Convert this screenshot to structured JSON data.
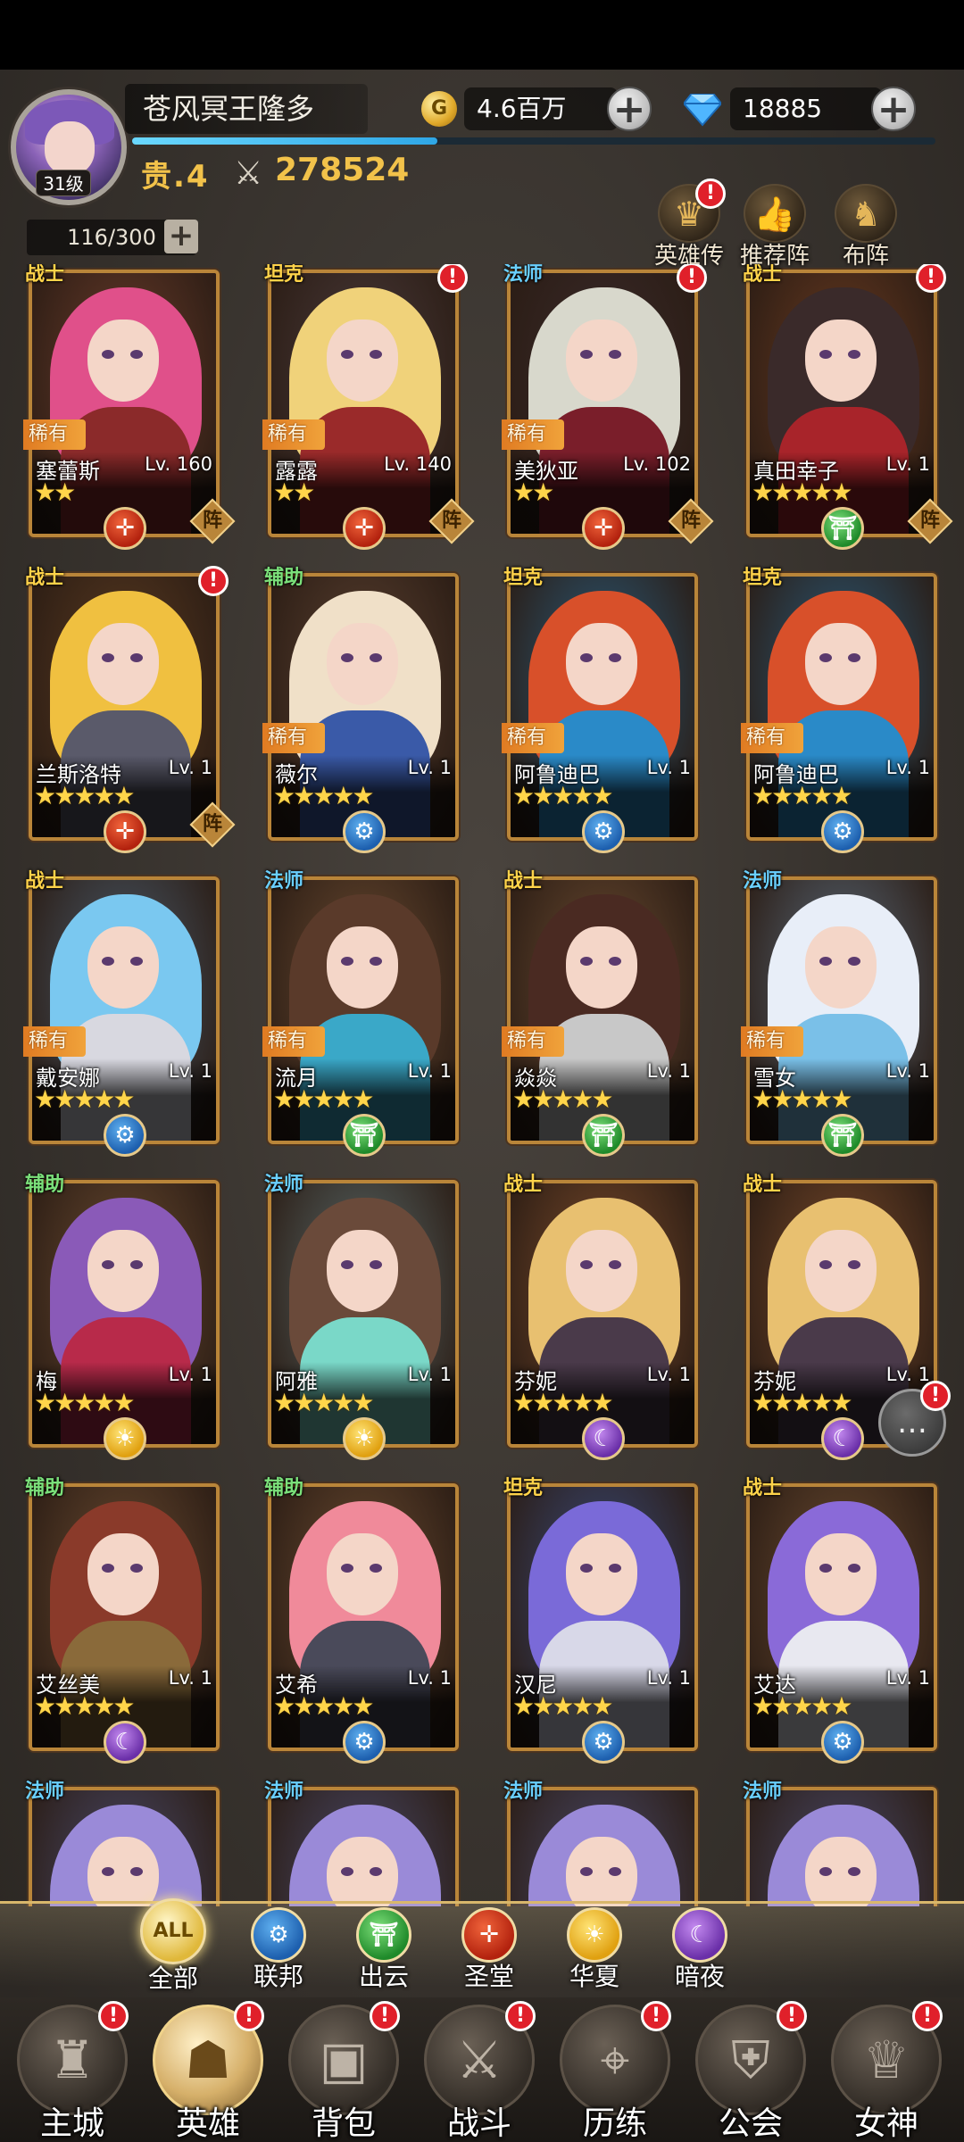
{
  "player": {
    "name": "苍风冥王隆多",
    "level_badge": "31级",
    "vip": "贵.4",
    "power": "278524",
    "xp_fraction": 0.38
  },
  "resources": {
    "coin_icon_glyph": "G",
    "gold": "4.6百万",
    "gems": "18885"
  },
  "capacity": "116/300",
  "top_actions": [
    {
      "label": "英雄传",
      "icon": "crown-icon",
      "glyph": "♛",
      "alert": true
    },
    {
      "label": "推荐阵",
      "icon": "thumbs-up-icon",
      "glyph": "👍",
      "alert": false
    },
    {
      "label": "布阵",
      "icon": "knight-icon",
      "glyph": "♞",
      "alert": false
    }
  ],
  "alert_mark": "!",
  "heroes": [
    {
      "role": "战士",
      "role_color": "#ffd34a",
      "rarity": "稀有",
      "name": "塞蕾斯",
      "level": "Lv. 160",
      "stars": "★★",
      "faction": "sacred",
      "formation": "阵",
      "alert": false,
      "hair": "#e0508a",
      "body": "#8b2a2a",
      "bg": "#6a3b2a"
    },
    {
      "role": "坦克",
      "role_color": "#ffd34a",
      "rarity": "稀有",
      "name": "露露",
      "level": "Lv. 140",
      "stars": "★★",
      "faction": "sacred",
      "formation": "阵",
      "alert": true,
      "hair": "#f0d27a",
      "body": "#9a2a2a",
      "bg": "#4a3a3a"
    },
    {
      "role": "法师",
      "role_color": "#6ad0ff",
      "rarity": "稀有",
      "name": "美狄亚",
      "level": "Lv. 102",
      "stars": "★★",
      "faction": "sacred",
      "formation": "阵",
      "alert": true,
      "hair": "#d8d8cc",
      "body": "#7a1e2a",
      "bg": "#3a2a2a"
    },
    {
      "role": "战士",
      "role_color": "#ffd34a",
      "rarity": "",
      "name": "真田幸子",
      "level": "Lv. 1",
      "stars": "★★★★★",
      "faction": "cloud",
      "formation": "阵",
      "alert": true,
      "hair": "#3a2a2a",
      "body": "#a8242a",
      "bg": "#6a3a20"
    },
    {
      "role": "战士",
      "role_color": "#ffd34a",
      "rarity": "",
      "name": "兰斯洛特",
      "level": "Lv. 1",
      "stars": "★★★★★",
      "faction": "sacred",
      "formation": "阵",
      "alert": true,
      "hair": "#f0c040",
      "body": "#5a5a6a",
      "bg": "#5a3a20"
    },
    {
      "role": "辅助",
      "role_color": "#7be07a",
      "rarity": "稀有",
      "name": "薇尔",
      "level": "Lv. 1",
      "stars": "★★★★★",
      "faction": "union",
      "formation": "",
      "alert": false,
      "hair": "#f0e0c8",
      "body": "#3a5aa8",
      "bg": "#5a4030"
    },
    {
      "role": "坦克",
      "role_color": "#ffd34a",
      "rarity": "稀有",
      "name": "阿鲁迪巴",
      "level": "Lv. 1",
      "stars": "★★★★★",
      "faction": "union",
      "formation": "",
      "alert": false,
      "hair": "#d8502a",
      "body": "#2a8ac8",
      "bg": "#2a5a7a"
    },
    {
      "role": "坦克",
      "role_color": "#ffd34a",
      "rarity": "稀有",
      "name": "阿鲁迪巴",
      "level": "Lv. 1",
      "stars": "★★★★★",
      "faction": "union",
      "formation": "",
      "alert": false,
      "hair": "#d8502a",
      "body": "#2a8ac8",
      "bg": "#2a5a7a"
    },
    {
      "role": "战士",
      "role_color": "#ffd34a",
      "rarity": "稀有",
      "name": "戴安娜",
      "level": "Lv. 1",
      "stars": "★★★★★",
      "faction": "union",
      "formation": "",
      "alert": false,
      "hair": "#7ac8f0",
      "body": "#d8d8e0",
      "bg": "#4a5a6a"
    },
    {
      "role": "法师",
      "role_color": "#6ad0ff",
      "rarity": "稀有",
      "name": "流月",
      "level": "Lv. 1",
      "stars": "★★★★★",
      "faction": "cloud",
      "formation": "",
      "alert": false,
      "hair": "#5a3a2a",
      "body": "#3aa8c8",
      "bg": "#6a4a30"
    },
    {
      "role": "战士",
      "role_color": "#ffd34a",
      "rarity": "稀有",
      "name": "焱焱",
      "level": "Lv. 1",
      "stars": "★★★★★",
      "faction": "cloud",
      "formation": "",
      "alert": false,
      "hair": "#4a2a22",
      "body": "#c8c8c8",
      "bg": "#6a4a30"
    },
    {
      "role": "法师",
      "role_color": "#6ad0ff",
      "rarity": "稀有",
      "name": "雪女",
      "level": "Lv. 1",
      "stars": "★★★★★",
      "faction": "cloud",
      "formation": "",
      "alert": false,
      "hair": "#e8eef8",
      "body": "#7ac0e8",
      "bg": "#5a6a7a"
    },
    {
      "role": "辅助",
      "role_color": "#7be07a",
      "rarity": "",
      "name": "梅",
      "level": "Lv. 1",
      "stars": "★★★★★",
      "faction": "huaxia",
      "formation": "",
      "alert": false,
      "hair": "#8a5ab8",
      "body": "#b82a4a",
      "bg": "#6a4a30"
    },
    {
      "role": "法师",
      "role_color": "#6ad0ff",
      "rarity": "",
      "name": "阿雅",
      "level": "Lv. 1",
      "stars": "★★★★★",
      "faction": "huaxia",
      "formation": "",
      "alert": false,
      "hair": "#6a4a3a",
      "body": "#7ad8c8",
      "bg": "#5a6a6a"
    },
    {
      "role": "战士",
      "role_color": "#ffd34a",
      "rarity": "",
      "name": "芬妮",
      "level": "Lv. 1",
      "stars": "★★★★★",
      "faction": "night",
      "formation": "",
      "alert": false,
      "hair": "#e8c070",
      "body": "#4a3a4a",
      "bg": "#7a4a2a"
    },
    {
      "role": "战士",
      "role_color": "#ffd34a",
      "rarity": "",
      "name": "芬妮",
      "level": "Lv. 1",
      "stars": "★★★★★",
      "faction": "night",
      "formation": "",
      "alert": false,
      "hair": "#e8c070",
      "body": "#4a3a4a",
      "bg": "#7a4a2a"
    },
    {
      "role": "辅助",
      "role_color": "#7be07a",
      "rarity": "",
      "name": "艾丝美",
      "level": "Lv. 1",
      "stars": "★★★★★",
      "faction": "night",
      "formation": "",
      "alert": false,
      "hair": "#8a3a2a",
      "body": "#8a6a3a",
      "bg": "#6a4a30"
    },
    {
      "role": "辅助",
      "role_color": "#7be07a",
      "rarity": "",
      "name": "艾希",
      "level": "Lv. 1",
      "stars": "★★★★★",
      "faction": "union",
      "formation": "",
      "alert": false,
      "hair": "#f08a9a",
      "body": "#4a4a5a",
      "bg": "#6a4a30"
    },
    {
      "role": "坦克",
      "role_color": "#ffd34a",
      "rarity": "",
      "name": "汉尼",
      "level": "Lv. 1",
      "stars": "★★★★★",
      "faction": "union",
      "formation": "",
      "alert": false,
      "hair": "#7a6ad8",
      "body": "#d8d8e8",
      "bg": "#3a4a7a"
    },
    {
      "role": "战士",
      "role_color": "#ffd34a",
      "rarity": "",
      "name": "艾达",
      "level": "Lv. 1",
      "stars": "★★★★★",
      "faction": "union",
      "formation": "",
      "alert": false,
      "hair": "#8a6ad8",
      "body": "#e8e8f0",
      "bg": "#6a4a30"
    },
    {
      "role": "法师",
      "role_color": "#6ad0ff",
      "rarity": "",
      "name": "",
      "level": "",
      "stars": "",
      "faction": "",
      "formation": "",
      "alert": false,
      "hair": "#9a8ad8",
      "body": "#6a7ab8",
      "bg": "#4a4a6a"
    },
    {
      "role": "法师",
      "role_color": "#6ad0ff",
      "rarity": "",
      "name": "",
      "level": "",
      "stars": "",
      "faction": "",
      "formation": "",
      "alert": false,
      "hair": "#9a8ad8",
      "body": "#6a7ab8",
      "bg": "#4a4a6a"
    },
    {
      "role": "法师",
      "role_color": "#6ad0ff",
      "rarity": "",
      "name": "",
      "level": "",
      "stars": "",
      "faction": "",
      "formation": "",
      "alert": false,
      "hair": "#9a8ad8",
      "body": "#6a7ab8",
      "bg": "#4a4a6a"
    },
    {
      "role": "法师",
      "role_color": "#6ad0ff",
      "rarity": "",
      "name": "",
      "level": "",
      "stars": "",
      "faction": "",
      "formation": "",
      "alert": false,
      "hair": "#9a8ad8",
      "body": "#6a7ab8",
      "bg": "#4a4a6a"
    }
  ],
  "faction_glyphs": {
    "sacred": "✛",
    "union": "⚙",
    "cloud": "⛩",
    "huaxia": "☀",
    "night": "☾"
  },
  "filters": [
    {
      "label": "全部",
      "key": "all",
      "icon": "all-filter-icon",
      "glyph": "ALL"
    },
    {
      "label": "联邦",
      "key": "union",
      "icon": "gear-faction-icon",
      "glyph": "⚙"
    },
    {
      "label": "出云",
      "key": "cloud",
      "icon": "torii-faction-icon",
      "glyph": "⛩"
    },
    {
      "label": "圣堂",
      "key": "sacred",
      "icon": "cross-faction-icon",
      "glyph": "✛"
    },
    {
      "label": "华夏",
      "key": "huaxia",
      "icon": "sun-faction-icon",
      "glyph": "☀"
    },
    {
      "label": "暗夜",
      "key": "night",
      "icon": "moon-faction-icon",
      "glyph": "☾"
    }
  ],
  "nav": [
    {
      "label": "主城",
      "icon": "castle-icon",
      "glyph": "♜",
      "active": false
    },
    {
      "label": "英雄",
      "icon": "hooded-hero-icon",
      "glyph": "☗",
      "active": true
    },
    {
      "label": "背包",
      "icon": "backpack-icon",
      "glyph": "▣",
      "active": false
    },
    {
      "label": "战斗",
      "icon": "crossed-swords-icon",
      "glyph": "⚔",
      "active": false
    },
    {
      "label": "历练",
      "icon": "map-pin-icon",
      "glyph": "⌖",
      "active": false
    },
    {
      "label": "公会",
      "icon": "shield-icon",
      "glyph": "⛨",
      "active": false
    },
    {
      "label": "女神",
      "icon": "goddess-icon",
      "glyph": "♕",
      "active": false
    }
  ],
  "chat_glyph": "…"
}
